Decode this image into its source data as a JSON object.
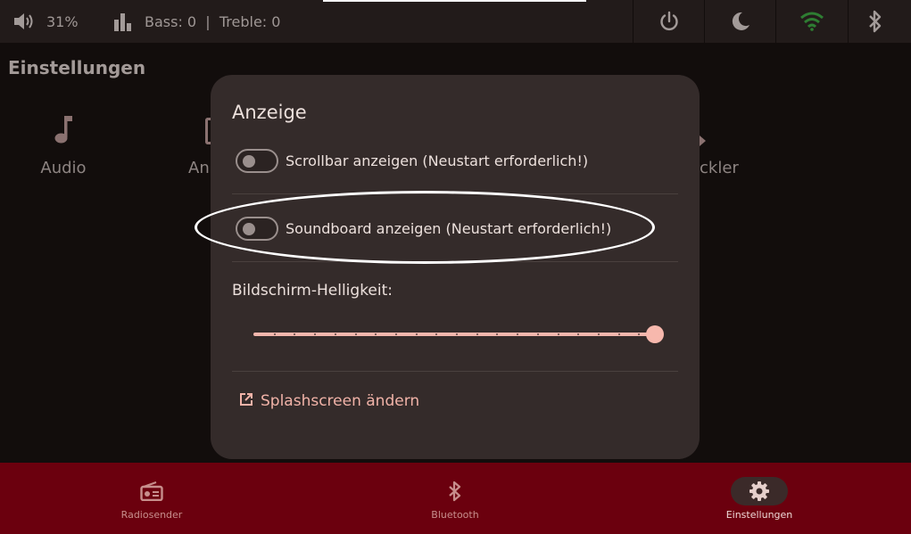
{
  "statusbar": {
    "volume": "31%",
    "eq_text": "Bass: 0  |  Treble: 0"
  },
  "page": {
    "title": "Einstellungen",
    "categories": {
      "audio": "Audio",
      "second_fragment": "An",
      "last_fragment": "ckler"
    }
  },
  "dialog": {
    "title": "Anzeige",
    "scrollbar_label": "Scrollbar anzeigen (Neustart erforderlich!)",
    "soundboard_label": "Soundboard anzeigen (Neustart erforderlich!)",
    "scrollbar_on": false,
    "soundboard_on": false,
    "brightness_label": "Bildschirm-Helligkeit:",
    "brightness_value_fraction": 1.0,
    "splash_link": "Splashscreen ändern"
  },
  "nav": {
    "items": [
      {
        "label": "Radiosender",
        "icon": "radio-icon",
        "active": false
      },
      {
        "label": "Bluetooth",
        "icon": "bluetooth-icon",
        "active": false
      },
      {
        "label": "Einstellungen",
        "icon": "gear-icon",
        "active": true
      }
    ]
  },
  "colors": {
    "accent": "#f7b8ad",
    "nav_background": "#6b000e",
    "wifi": "#2e7d32"
  }
}
